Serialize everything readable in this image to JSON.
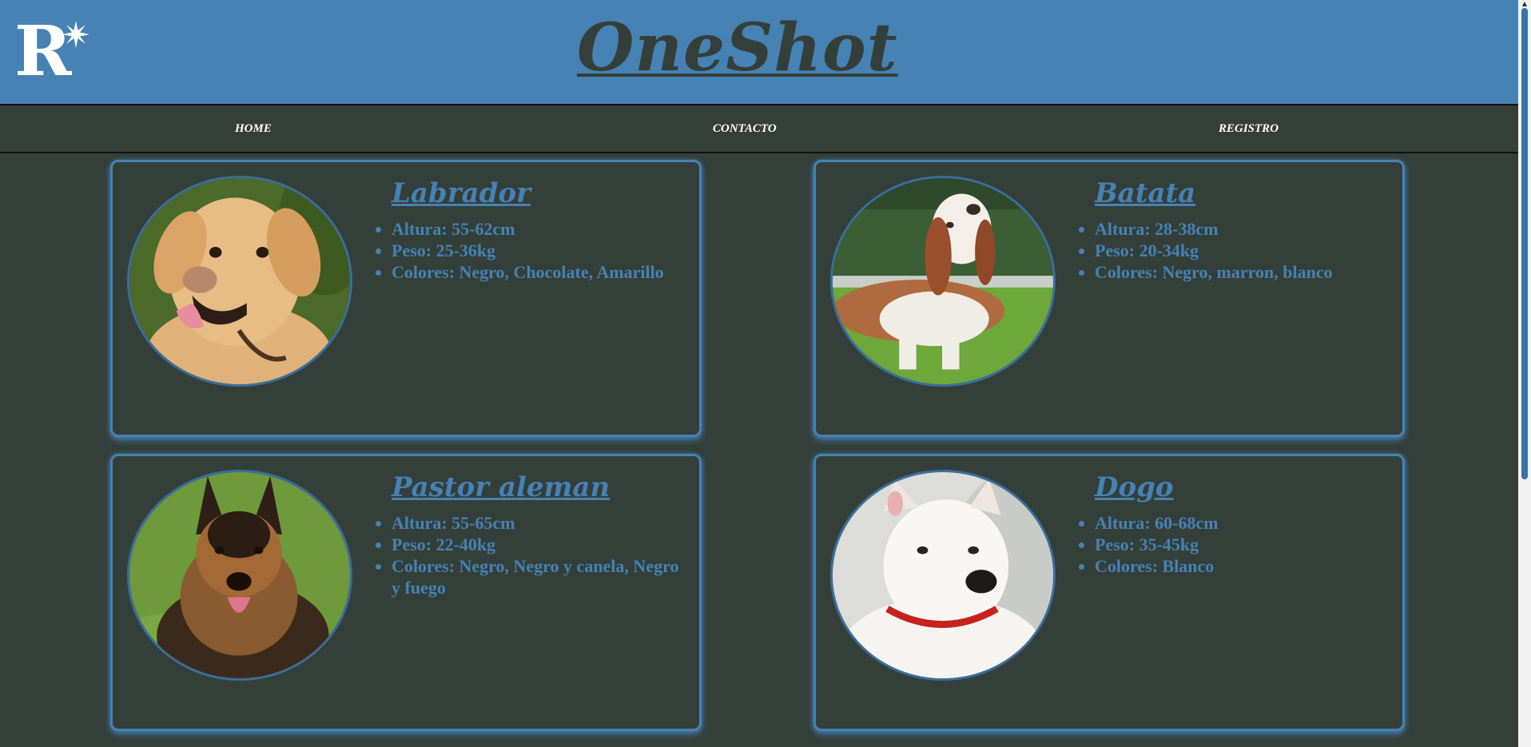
{
  "header": {
    "logo_letter": "R",
    "title": "OneShot"
  },
  "nav": {
    "items": [
      "HOME",
      "CONTACTO",
      "REGISTRO"
    ]
  },
  "colors": {
    "header_bg": "#4682b4",
    "page_bg": "#343f3a",
    "accent": "#4682b4",
    "nav_text": "#ffffff"
  },
  "dogs": [
    {
      "name": "Labrador",
      "photo_icon": "labrador-photo",
      "details": [
        "Altura: 55-62cm",
        "Peso: 25-36kg",
        "Colores: Negro, Chocolate, Amarillo"
      ]
    },
    {
      "name": "Batata",
      "photo_icon": "basset-hound-photo",
      "details": [
        "Altura: 28-38cm",
        "Peso: 20-34kg",
        "Colores: Negro, marron, blanco"
      ]
    },
    {
      "name": "Pastor aleman",
      "photo_icon": "german-shepherd-photo",
      "details": [
        "Altura: 55-65cm",
        "Peso: 22-40kg",
        "Colores: Negro, Negro y canela, Negro y fuego"
      ]
    },
    {
      "name": "Dogo",
      "photo_icon": "dogo-argentino-photo",
      "details": [
        "Altura: 60-68cm",
        "Peso: 35-45kg",
        "Colores: Blanco"
      ]
    }
  ]
}
